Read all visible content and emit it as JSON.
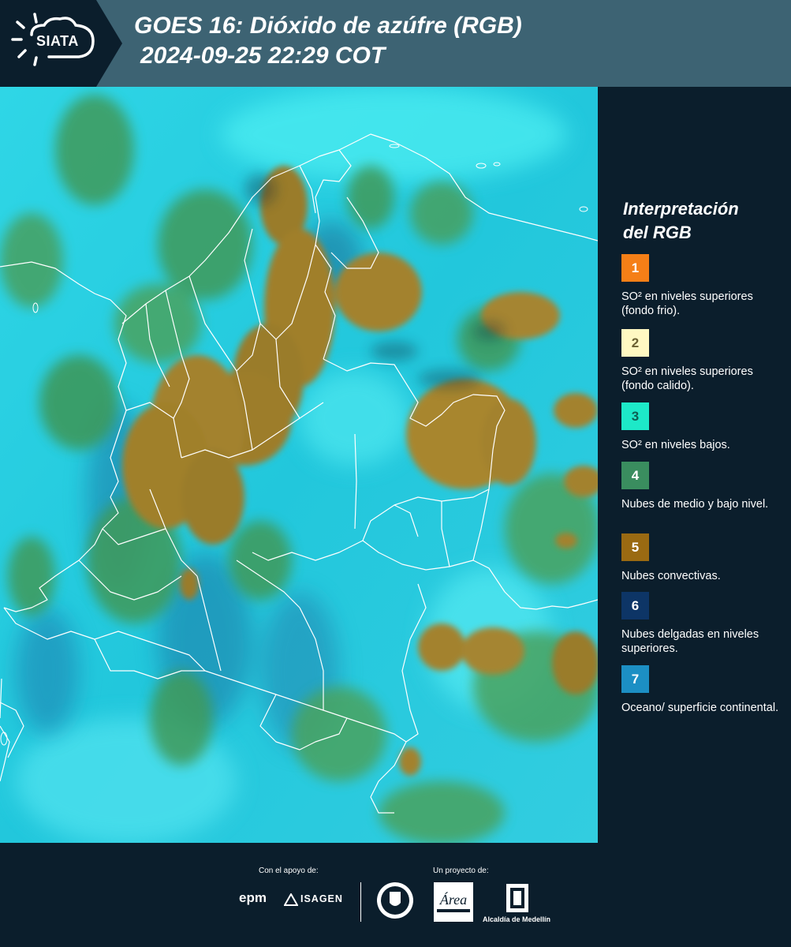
{
  "header": {
    "title_line1": "GOES 16: Dióxido de azúfre (RGB)",
    "title_line2": "2024-09-25 22:29 COT",
    "logo_text": "SIATA",
    "logo_icon": "sun-cloud-icon"
  },
  "legend": {
    "title_line1": "Interpretación",
    "title_line2": "del RGB",
    "items": [
      {
        "number": "1",
        "color": "#f57f17",
        "text": "SO² en niveles superiores (fondo frio)."
      },
      {
        "number": "2",
        "color": "#fff8c2",
        "text": "SO² en niveles superiores (fondo calido)."
      },
      {
        "number": "3",
        "color": "#1de9c8",
        "text": "SO² en niveles bajos."
      },
      {
        "number": "4",
        "color": "#3a8d5f",
        "text": "Nubes de medio y bajo nivel."
      },
      {
        "number": "5",
        "color": "#9a6a12",
        "text": "Nubes convectivas."
      },
      {
        "number": "6",
        "color": "#0d3566",
        "text": "Nubes delgadas en niveles superiores."
      },
      {
        "number": "7",
        "color": "#1c8fc4",
        "text": "Oceano/ superficie continental."
      }
    ]
  },
  "footer": {
    "support_label": "Con el apoyo de:",
    "project_label": "Un proyecto de:",
    "epm_text": "epm",
    "isagen_text": "ISAGEN",
    "area_text": "Área",
    "alcaldia_text": "Alcaldía de Medellín"
  },
  "colors": {
    "header_bg": "#3d6373",
    "page_bg": "#0b1e2c",
    "map_sea": "#22d4e3",
    "cloud_brown": "#9a7b2a",
    "cloud_green": "#3f9a5a"
  }
}
